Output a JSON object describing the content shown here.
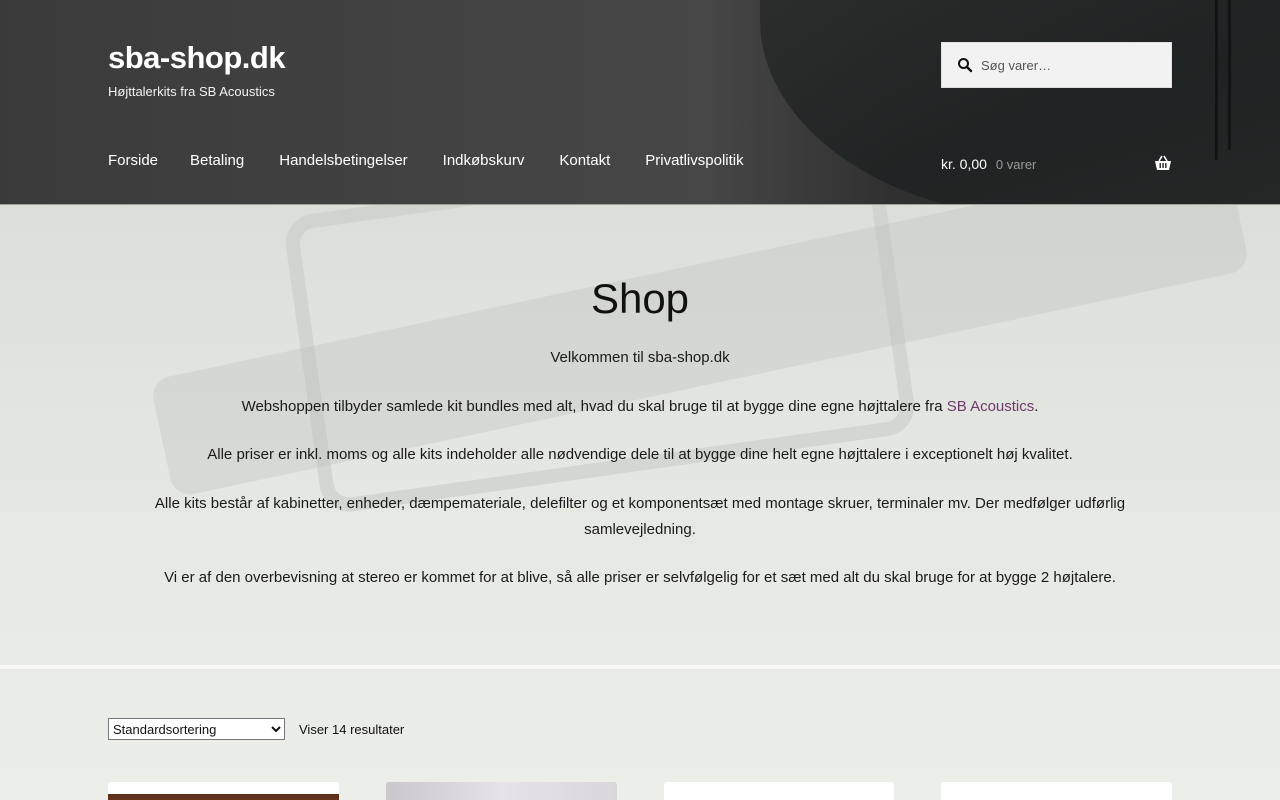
{
  "site": {
    "title": "sba-shop.dk",
    "tagline": "Højttalerkits fra SB Acoustics"
  },
  "search": {
    "placeholder": "Søg varer…"
  },
  "nav": {
    "items": [
      {
        "label": "Forside"
      },
      {
        "label": "Betaling"
      },
      {
        "label": "Handelsbetingelser"
      },
      {
        "label": "Indkøbskurv"
      },
      {
        "label": "Kontakt"
      },
      {
        "label": "Privatlivspolitik"
      }
    ]
  },
  "cart": {
    "amount": "kr. 0,00",
    "count": "0 varer",
    "icon": "basket-icon"
  },
  "page": {
    "title": "Shop",
    "intro": {
      "p1": "Velkommen til sba-shop.dk",
      "p2_before": "Webshoppen tilbyder samlede kit bundles med alt, hvad du skal bruge til at bygge dine egne højttalere fra ",
      "p2_link": "SB Acoustics",
      "p2_after": ".",
      "p3": "Alle priser er inkl. moms og alle kits indeholder alle nødvendige dele til at bygge dine helt egne højttalere i exceptionelt høj kvalitet.",
      "p4": "Alle kits består af kabinetter, enheder, dæmpemateriale, delefilter og et komponentsæt med montage skruer, terminaler mv. Der medfølger udførlig samlevejledning.",
      "p5": "Vi er af den overbevisning at stereo er kommet for at blive, så alle priser er selvfølgelig for et sæt med alt du skal bruge for at bygge 2 højtalere."
    }
  },
  "shop": {
    "sort_selected": "Standardsortering",
    "result_count": "Viser 14 resultater"
  },
  "colors": {
    "link": "#6d3a6b",
    "header_bg": "#3a3a3a",
    "search_bg": "#f2f2f2"
  }
}
